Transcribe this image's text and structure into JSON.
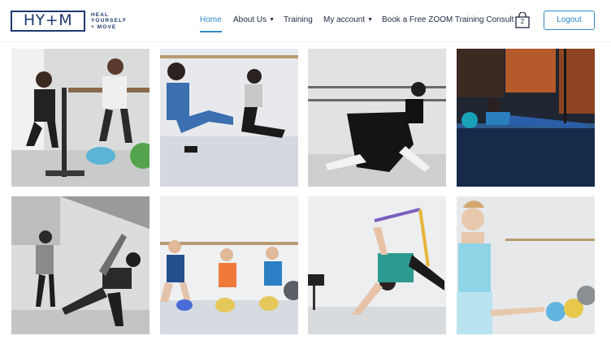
{
  "header": {
    "logo_mark": "HY+M",
    "logo_tagline_line1": "HEAL",
    "logo_tagline_line2": "YOURSELF",
    "logo_tagline_line3": "+ MOVE"
  },
  "nav": {
    "home": "Home",
    "about": "About Us",
    "training": "Training",
    "account": "My account",
    "consult": "Book a Free ZOOM Training Consult",
    "cart_count": "2",
    "logout": "Logout"
  },
  "colors": {
    "brand_navy": "#1e3a6f",
    "accent_blue": "#2f8ac6"
  },
  "icons": {
    "cart": "shopping-bag-icon",
    "about_caret": "chevron-down-icon",
    "account_caret": "chevron-down-icon"
  },
  "gallery": {
    "photos": [
      {
        "subject": "trainer-assisting-dancer-at-barre"
      },
      {
        "subject": "two-dancers-stretching-on-floor"
      },
      {
        "subject": "ballerina-in-tutu-black-and-white"
      },
      {
        "subject": "dancer-lying-on-stage-floor"
      },
      {
        "subject": "partner-stretch-black-and-white"
      },
      {
        "subject": "three-dancers-seated-on-balls"
      },
      {
        "subject": "dancer-stretching-with-band"
      },
      {
        "subject": "dancer-in-blue-leotard-portrait"
      }
    ]
  }
}
